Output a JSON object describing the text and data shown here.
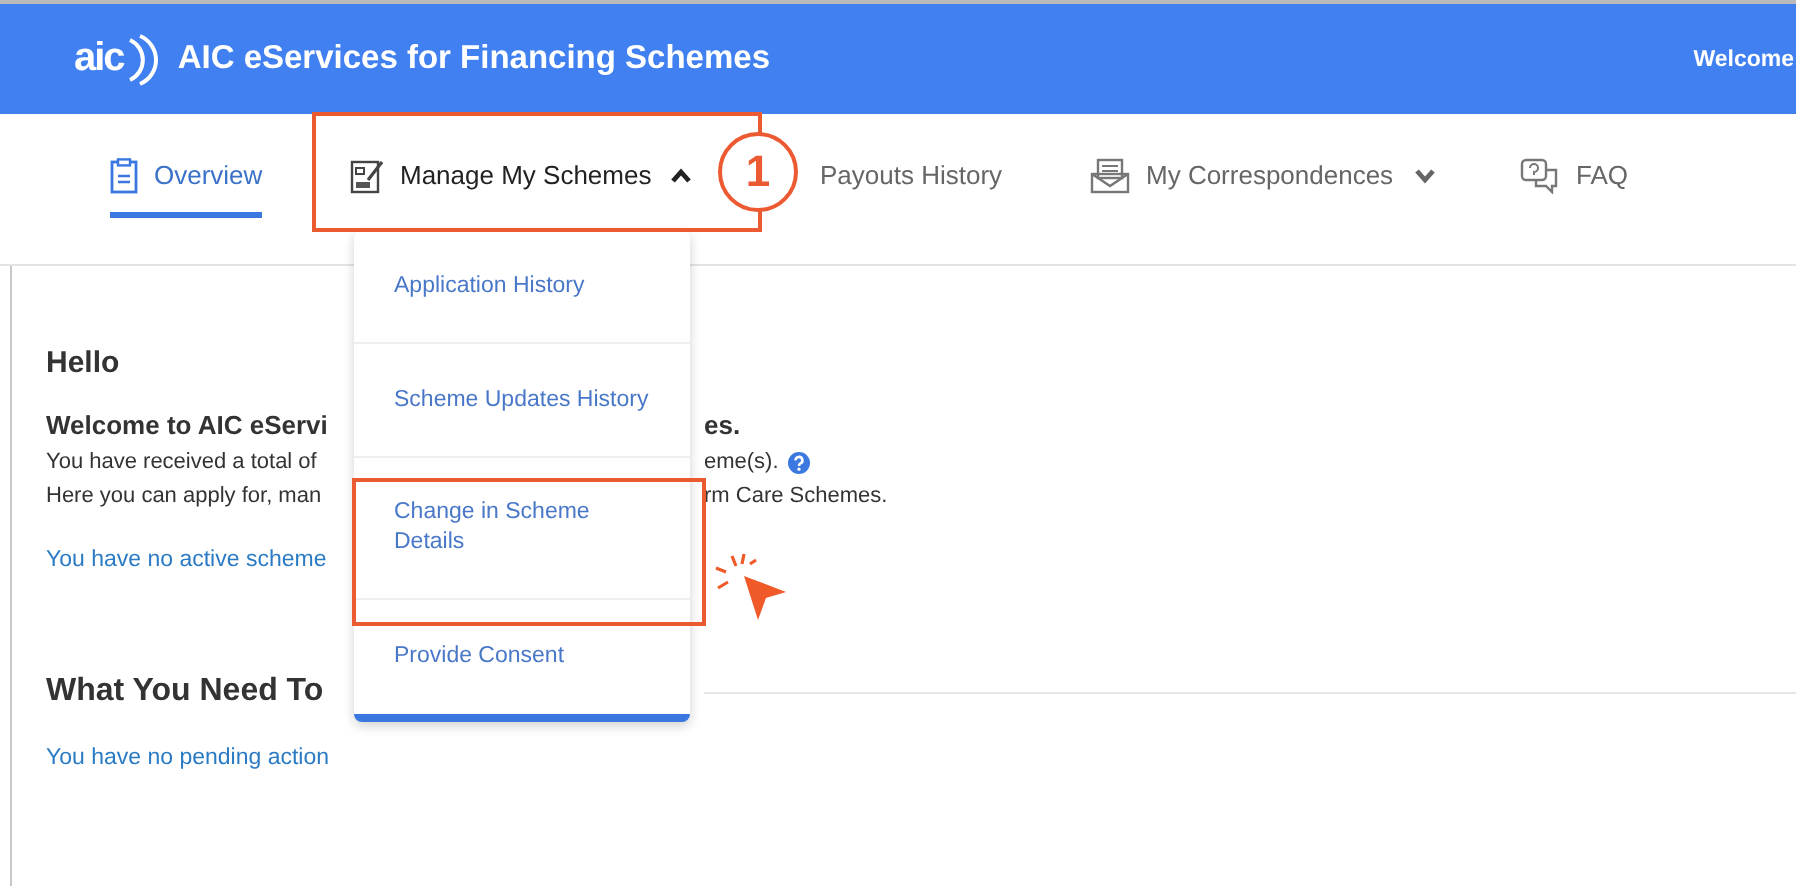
{
  "header": {
    "logo_text": "aic",
    "title": "AIC eServices for Financing Schemes",
    "welcome": "Welcome"
  },
  "nav": {
    "tabs": [
      {
        "label": "Overview",
        "selected": true
      },
      {
        "label": "Manage My Schemes",
        "selected": false,
        "expanded": true
      },
      {
        "label": "Payouts History",
        "selected": false
      },
      {
        "label": "My Correspondences",
        "selected": false,
        "expanded": false
      },
      {
        "label": "FAQ",
        "selected": false
      }
    ]
  },
  "dropdown": {
    "items": [
      "Application History",
      "Scheme Updates History",
      "Change in Scheme Details",
      "Provide Consent"
    ]
  },
  "content": {
    "greeting": "Hello",
    "welcome_heading": [
      "Welcome to AIC eServi",
      "es."
    ],
    "lines": [
      {
        "left": "You have received a total of",
        "right": "eme(s).",
        "help": true
      },
      {
        "left": "Here you can apply for, man",
        "right": "rm Care Schemes.",
        "help": false
      }
    ],
    "active_link": "You have no active scheme",
    "section_heading": "What You Need To",
    "pending_link": "You have no pending action"
  },
  "annotation": {
    "step": "1"
  }
}
